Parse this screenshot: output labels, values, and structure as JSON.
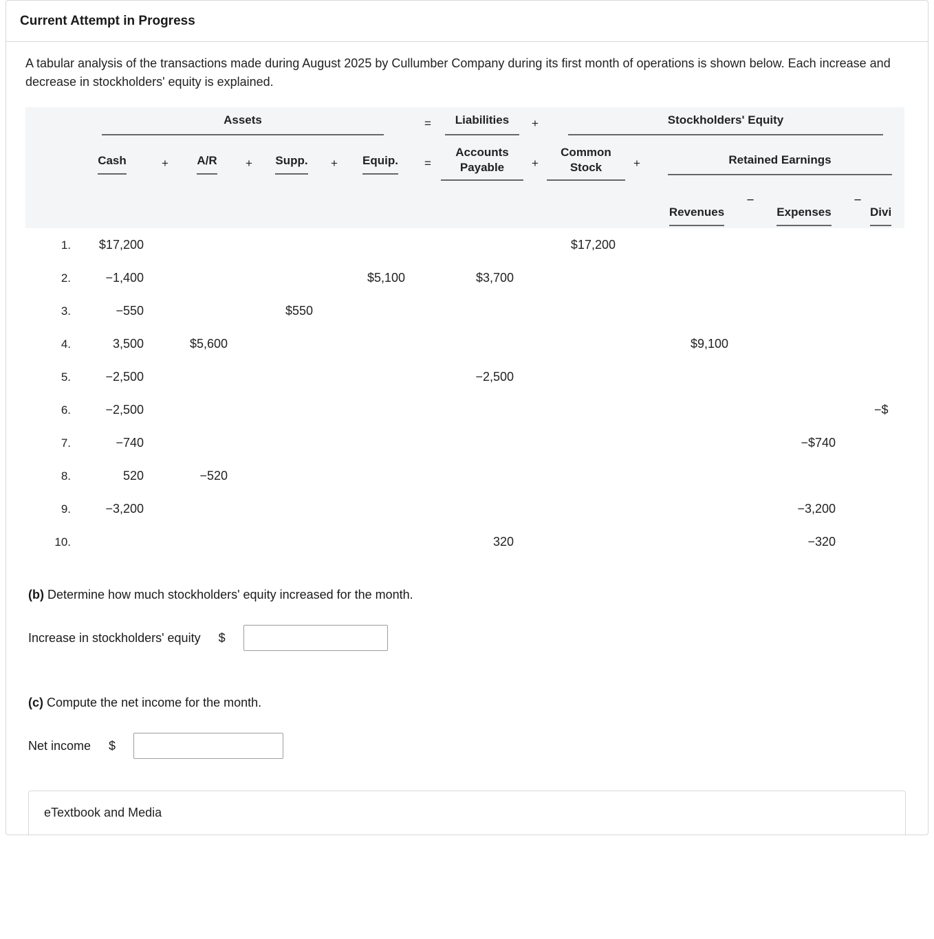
{
  "heading": "Current Attempt in Progress",
  "prompt": "A tabular analysis of the transactions made during August 2025 by Cullumber Company during its first month of operations is shown below. Each increase and decrease in stockholders' equity is explained.",
  "groups": {
    "assets": "Assets",
    "liabilities": "Liabilities",
    "equity": "Stockholders' Equity",
    "retained": "Retained Earnings"
  },
  "cols": {
    "cash": "Cash",
    "ar": "A/R",
    "supp": "Supp.",
    "equip": "Equip.",
    "ap": "Accounts Payable",
    "cs": "Common Stock",
    "rev": "Revenues",
    "exp": "Expenses",
    "div": "Divi"
  },
  "ops": {
    "plus": "+",
    "eq": "=",
    "minus": "−"
  },
  "rows": [
    {
      "n": "1.",
      "cash": "$17,200",
      "ar": "",
      "supp": "",
      "equip": "",
      "ap": "",
      "cs": "$17,200",
      "rev": "",
      "exp": "",
      "div": ""
    },
    {
      "n": "2.",
      "cash": "−1,400",
      "ar": "",
      "supp": "",
      "equip": "$5,100",
      "ap": "$3,700",
      "cs": "",
      "rev": "",
      "exp": "",
      "div": ""
    },
    {
      "n": "3.",
      "cash": "−550",
      "ar": "",
      "supp": "$550",
      "equip": "",
      "ap": "",
      "cs": "",
      "rev": "",
      "exp": "",
      "div": ""
    },
    {
      "n": "4.",
      "cash": "3,500",
      "ar": "$5,600",
      "supp": "",
      "equip": "",
      "ap": "",
      "cs": "",
      "rev": "$9,100",
      "exp": "",
      "div": ""
    },
    {
      "n": "5.",
      "cash": "−2,500",
      "ar": "",
      "supp": "",
      "equip": "",
      "ap": "−2,500",
      "cs": "",
      "rev": "",
      "exp": "",
      "div": ""
    },
    {
      "n": "6.",
      "cash": "−2,500",
      "ar": "",
      "supp": "",
      "equip": "",
      "ap": "",
      "cs": "",
      "rev": "",
      "exp": "",
      "div": "−$"
    },
    {
      "n": "7.",
      "cash": "−740",
      "ar": "",
      "supp": "",
      "equip": "",
      "ap": "",
      "cs": "",
      "rev": "",
      "exp": "−$740",
      "div": ""
    },
    {
      "n": "8.",
      "cash": "520",
      "ar": "−520",
      "supp": "",
      "equip": "",
      "ap": "",
      "cs": "",
      "rev": "",
      "exp": "",
      "div": ""
    },
    {
      "n": "9.",
      "cash": "−3,200",
      "ar": "",
      "supp": "",
      "equip": "",
      "ap": "",
      "cs": "",
      "rev": "",
      "exp": "−3,200",
      "div": ""
    },
    {
      "n": "10.",
      "cash": "",
      "ar": "",
      "supp": "",
      "equip": "",
      "ap": "320",
      "cs": "",
      "rev": "",
      "exp": "−320",
      "div": ""
    }
  ],
  "part_b": {
    "prompt_prefix": "(b)",
    "prompt_text": " Determine how much stockholders' equity increased for the month.",
    "label": "Increase in stockholders' equity",
    "currency": "$",
    "value": ""
  },
  "part_c": {
    "prompt_prefix": "(c)",
    "prompt_text": " Compute the net income for the month.",
    "label": "Net income",
    "currency": "$",
    "value": ""
  },
  "etextbook": "eTextbook and Media",
  "chart_data": {
    "type": "table",
    "title": "Tabular analysis of transactions — Cullumber Company, August 2025",
    "columns": [
      "Cash",
      "A/R",
      "Supp.",
      "Equip.",
      "Accounts Payable",
      "Common Stock",
      "Revenues",
      "Expenses",
      "Dividends"
    ],
    "rows": [
      [
        17200,
        null,
        null,
        null,
        null,
        17200,
        null,
        null,
        null
      ],
      [
        -1400,
        null,
        null,
        5100,
        3700,
        null,
        null,
        null,
        null
      ],
      [
        -550,
        null,
        550,
        null,
        null,
        null,
        null,
        null,
        null
      ],
      [
        3500,
        5600,
        null,
        null,
        null,
        null,
        9100,
        null,
        null
      ],
      [
        -2500,
        null,
        null,
        null,
        -2500,
        null,
        null,
        null,
        null
      ],
      [
        -2500,
        null,
        null,
        null,
        null,
        null,
        null,
        null,
        null
      ],
      [
        -740,
        null,
        null,
        null,
        null,
        null,
        null,
        -740,
        null
      ],
      [
        520,
        -520,
        null,
        null,
        null,
        null,
        null,
        null,
        null
      ],
      [
        -3200,
        null,
        null,
        null,
        null,
        null,
        null,
        -3200,
        null
      ],
      [
        null,
        null,
        null,
        null,
        320,
        null,
        null,
        -320,
        null
      ]
    ]
  }
}
